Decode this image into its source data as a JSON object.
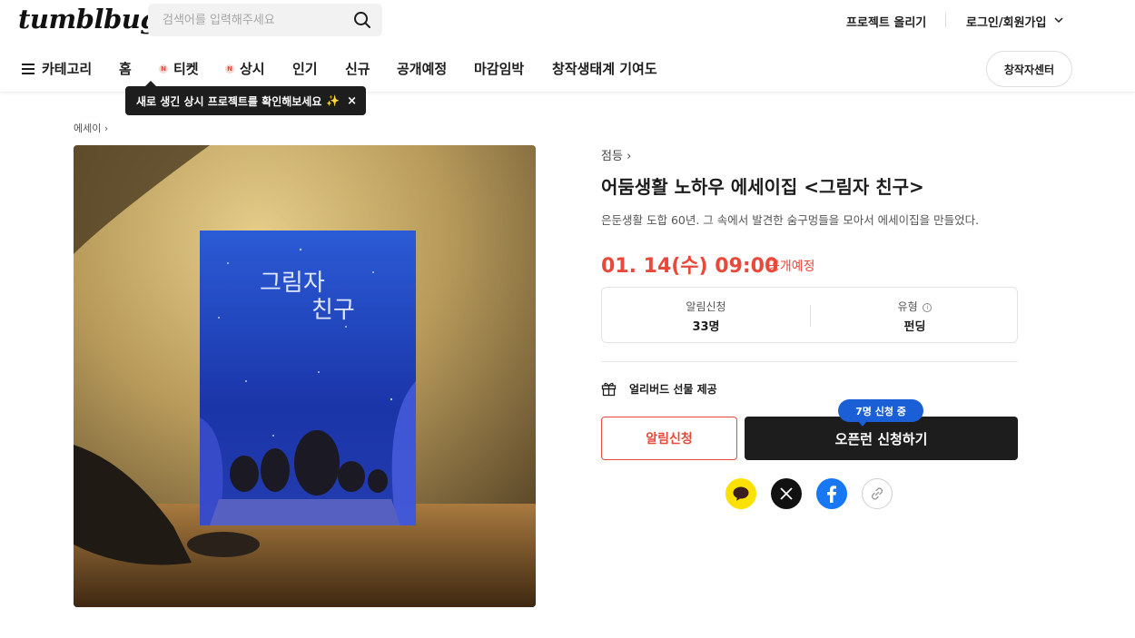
{
  "header": {
    "logo": "tumblbug",
    "search_placeholder": "검색어를 입력해주세요",
    "upload_project": "프로젝트 올리기",
    "login": "로그인/회원가입"
  },
  "nav": {
    "category": "카테고리",
    "home": "홈",
    "ticket": "티켓",
    "always": "상시",
    "popular": "인기",
    "new": "신규",
    "upcoming": "공개예정",
    "closing": "마감임박",
    "contribution": "창작생태계 기여도",
    "new_badge": "N",
    "creator_center": "창작자센터"
  },
  "tooltip": {
    "text": "새로 생긴 상시 프로젝트를 확인해보세요",
    "close": "×"
  },
  "breadcrumb": "에세이",
  "project": {
    "category_link": "점등",
    "title": "어둠생활 노하우 에세이집 <그림자 친구>",
    "subtitle": "은둔생활 도합 60년. 그 속에서 발견한 숨구멍들을 모아서 에세이집을 만들었다.",
    "open_date": "01. 14(수) 09:00",
    "open_status": "공개예정",
    "stats": {
      "notify_label": "알림신청",
      "notify_value": "33명",
      "type_label": "유형",
      "type_value": "펀딩"
    },
    "early_bird": "얼리버드 선물 제공",
    "notify_button": "알림신청",
    "open_button": "오픈런 신청하기",
    "applicants_badge": "7명 신청 중"
  },
  "book": {
    "title_line1": "그림자",
    "title_line2": "친구"
  },
  "colors": {
    "accent": "#e8493a",
    "badge": "#1a5fd6",
    "dark": "#1d1d1d",
    "kakao": "#fae100",
    "facebook": "#1877f2"
  }
}
